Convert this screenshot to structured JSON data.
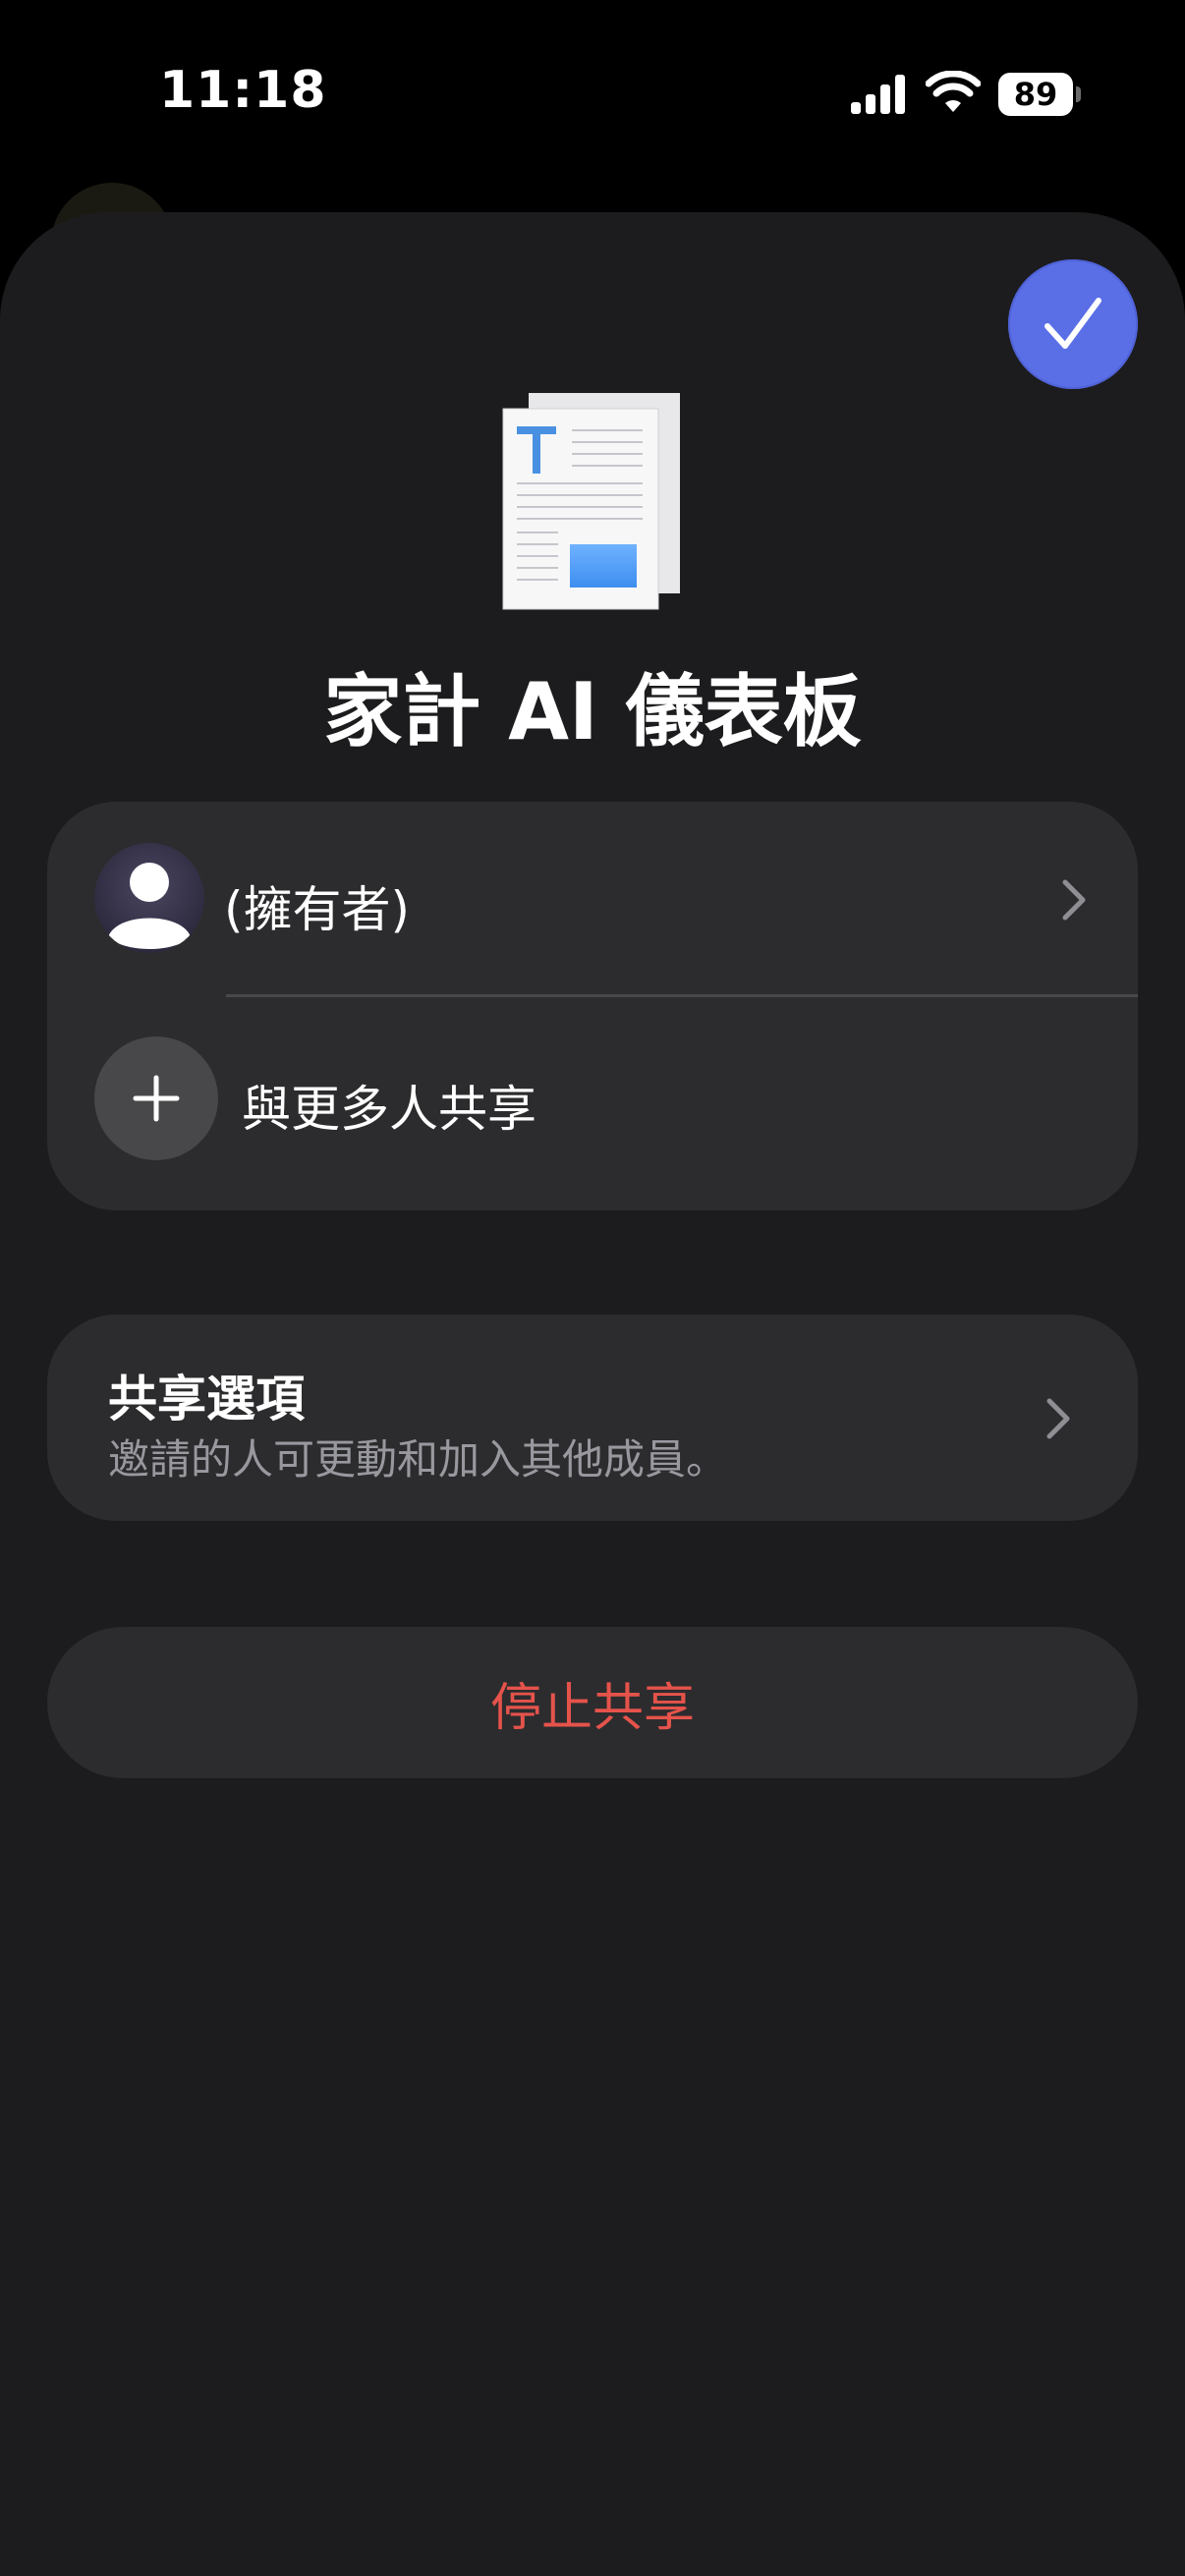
{
  "status_bar": {
    "time": "11:18",
    "battery_level": "89",
    "signal_icon": "cellular-signal-icon",
    "wifi_icon": "wifi-icon"
  },
  "header": {
    "done_icon": "checkmark-icon",
    "document_icon": "text-document-icon",
    "title": "家計 AI 儀表板"
  },
  "people": {
    "owner_label": "(擁有者)",
    "owner_avatar_icon": "person-silhouette-icon",
    "share_more_label": "與更多人共享",
    "share_more_icon": "plus-icon"
  },
  "share_options": {
    "title": "共享選項",
    "subtitle": "邀請的人可更動和加入其他成員。"
  },
  "stop_sharing": {
    "label": "停止共享"
  },
  "colors": {
    "accent": "#5a6ee6",
    "destructive": "#e5534b",
    "sheet_background": "#1c1c1e",
    "card_background": "#2c2c2e",
    "secondary_text": "#98989f"
  }
}
